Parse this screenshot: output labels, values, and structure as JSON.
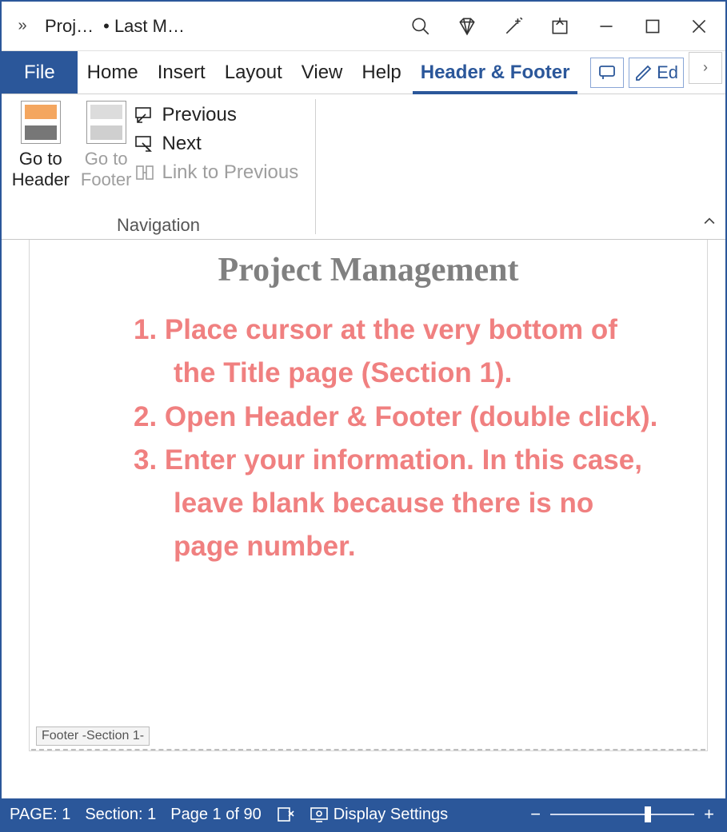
{
  "titlebar": {
    "doc_name": "Proj…",
    "autosave": "• Last M…"
  },
  "tabs": {
    "file": "File",
    "home": "Home",
    "insert": "Insert",
    "layout": "Layout",
    "view": "View",
    "help": "Help",
    "header_footer": "Header & Footer",
    "editing_short": "Ed"
  },
  "ribbon": {
    "group_title": "Navigation",
    "goto_header_l1": "Go to",
    "goto_header_l2": "Header",
    "goto_footer_l1": "Go to",
    "goto_footer_l2": "Footer",
    "previous": "Previous",
    "next": "Next",
    "link_to_previous": "Link to Previous"
  },
  "document": {
    "title": "Project Management",
    "step1": "1. Place cursor at the very bottom of the Title page (Section 1).",
    "step2": "2. Open Header & Footer (double click).",
    "step3": "3. Enter your information. In this case, leave blank because there is no page number.",
    "footer_tag": "Footer -Section 1-"
  },
  "status": {
    "page_word": "PAGE: 1",
    "section": "Section: 1",
    "page_of": "Page 1 of 90",
    "display_settings": "Display Settings"
  }
}
